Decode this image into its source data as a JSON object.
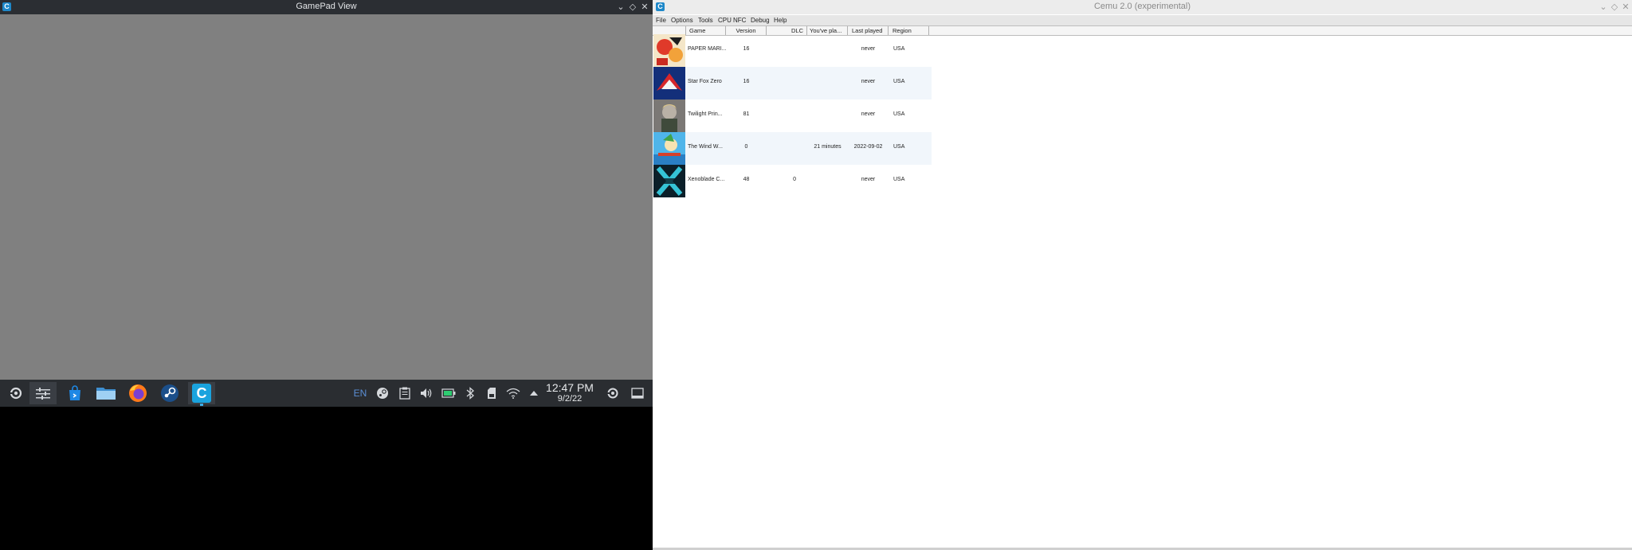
{
  "gamepad_window": {
    "title": "GamePad View",
    "controls": [
      "⌄",
      "◇",
      "✕"
    ]
  },
  "taskbar": {
    "apps": [
      "start-menu",
      "system-settings",
      "discover-store",
      "file-manager",
      "firefox",
      "steam",
      "cemu"
    ],
    "tray": {
      "language": "EN",
      "time": "12:47 PM",
      "date": "9/2/22"
    }
  },
  "cemu": {
    "title": "Cemu 2.0 (experimental)",
    "controls": [
      "⌄",
      "◇",
      "✕"
    ],
    "menu": [
      "File",
      "Options",
      "Tools",
      "CPU",
      "NFC",
      "Debug",
      "Help"
    ],
    "columns": [
      "Game",
      "Version",
      "DLC",
      "You've pla...",
      "Last played",
      "Region"
    ],
    "games": [
      {
        "name": "PAPER MARI...",
        "version": "16",
        "dlc": "",
        "played": "",
        "last": "never",
        "region": "USA",
        "thumb_color": "#d9482b"
      },
      {
        "name": "Star Fox Zero",
        "version": "16",
        "dlc": "",
        "played": "",
        "last": "never",
        "region": "USA",
        "thumb_color": "#1c3d8f"
      },
      {
        "name": "Twilight Prin...",
        "version": "81",
        "dlc": "",
        "played": "",
        "last": "never",
        "region": "USA",
        "thumb_color": "#6d6b68"
      },
      {
        "name": "The Wind W...",
        "version": "0",
        "dlc": "",
        "played": "21 minutes",
        "last": "2022-09-02",
        "region": "USA",
        "thumb_color": "#3aa3df"
      },
      {
        "name": "Xenoblade C...",
        "version": "48",
        "dlc": "0",
        "played": "",
        "last": "never",
        "region": "USA",
        "thumb_color": "#0d2a35"
      }
    ]
  }
}
